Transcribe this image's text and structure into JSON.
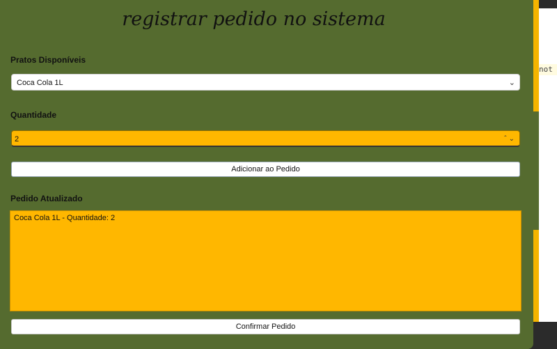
{
  "modal": {
    "title": "registrar pedido no sistema",
    "dishes_label": "Pratos Disponíveis",
    "dish_selected": "Coca Cola 1L",
    "quantity_label": "Quantidade",
    "quantity_value": "2",
    "add_button": "Adicionar ao Pedido",
    "order_label": "Pedido Atualizado",
    "order_text": "Coca Cola 1L - Quantidade: 2",
    "confirm_button": "Confirmar Pedido"
  },
  "background": {
    "code_snippet": "not"
  },
  "colors": {
    "modal_bg": "#556b2f",
    "accent": "#ffb700"
  }
}
